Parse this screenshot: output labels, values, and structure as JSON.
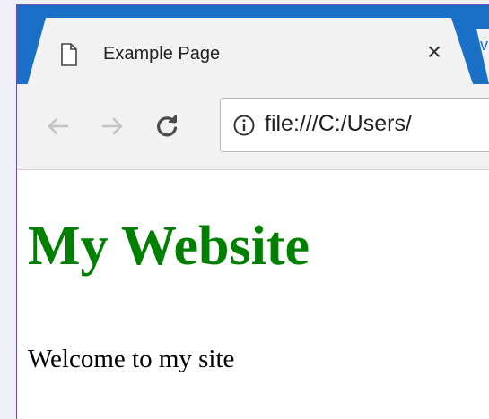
{
  "browser": {
    "tab": {
      "title": "Example Page",
      "close_glyph": "×",
      "icon": "page-icon"
    },
    "new_tab_glyph": "v",
    "toolbar": {
      "back_icon": "back-arrow-icon",
      "forward_icon": "forward-arrow-icon",
      "reload_icon": "reload-icon",
      "info_icon": "info-icon",
      "address": "file:///C:/Users/"
    },
    "colors": {
      "tabstrip": "#1a6fc7",
      "chrome": "#f2f2f2"
    }
  },
  "page": {
    "heading": "My Website",
    "paragraph": "Welcome to my site",
    "heading_color": "#008000"
  }
}
